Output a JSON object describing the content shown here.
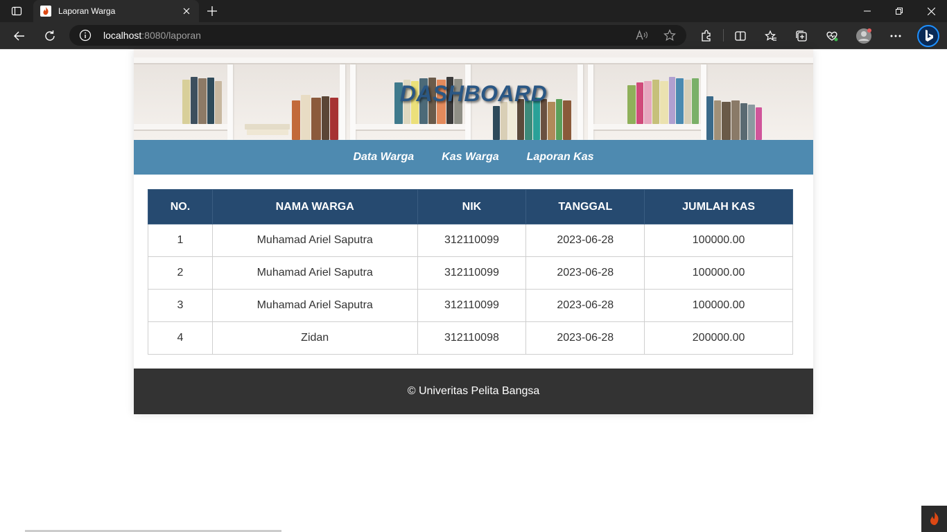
{
  "browser": {
    "tab_title": "Laporan Warga",
    "url_host": "localhost",
    "url_path": ":8080/laporan"
  },
  "header": {
    "title": "DASHBOARD"
  },
  "nav": {
    "items": [
      "Data Warga",
      "Kas Warga",
      "Laporan Kas"
    ]
  },
  "table": {
    "columns": [
      "NO.",
      "NAMA WARGA",
      "NIK",
      "TANGGAL",
      "JUMLAH KAS"
    ],
    "rows": [
      [
        "1",
        "Muhamad Ariel Saputra",
        "312110099",
        "2023-06-28",
        "100000.00"
      ],
      [
        "2",
        "Muhamad Ariel Saputra",
        "312110099",
        "2023-06-28",
        "100000.00"
      ],
      [
        "3",
        "Muhamad Ariel Saputra",
        "312110099",
        "2023-06-28",
        "100000.00"
      ],
      [
        "4",
        "Zidan",
        "312110098",
        "2023-06-28",
        "200000.00"
      ]
    ]
  },
  "footer": {
    "text": "© Univeritas Pelita Bangsa"
  },
  "colors": {
    "nav_bg": "#4e8ab0",
    "table_header_bg": "#264a70",
    "footer_bg": "#333333"
  }
}
